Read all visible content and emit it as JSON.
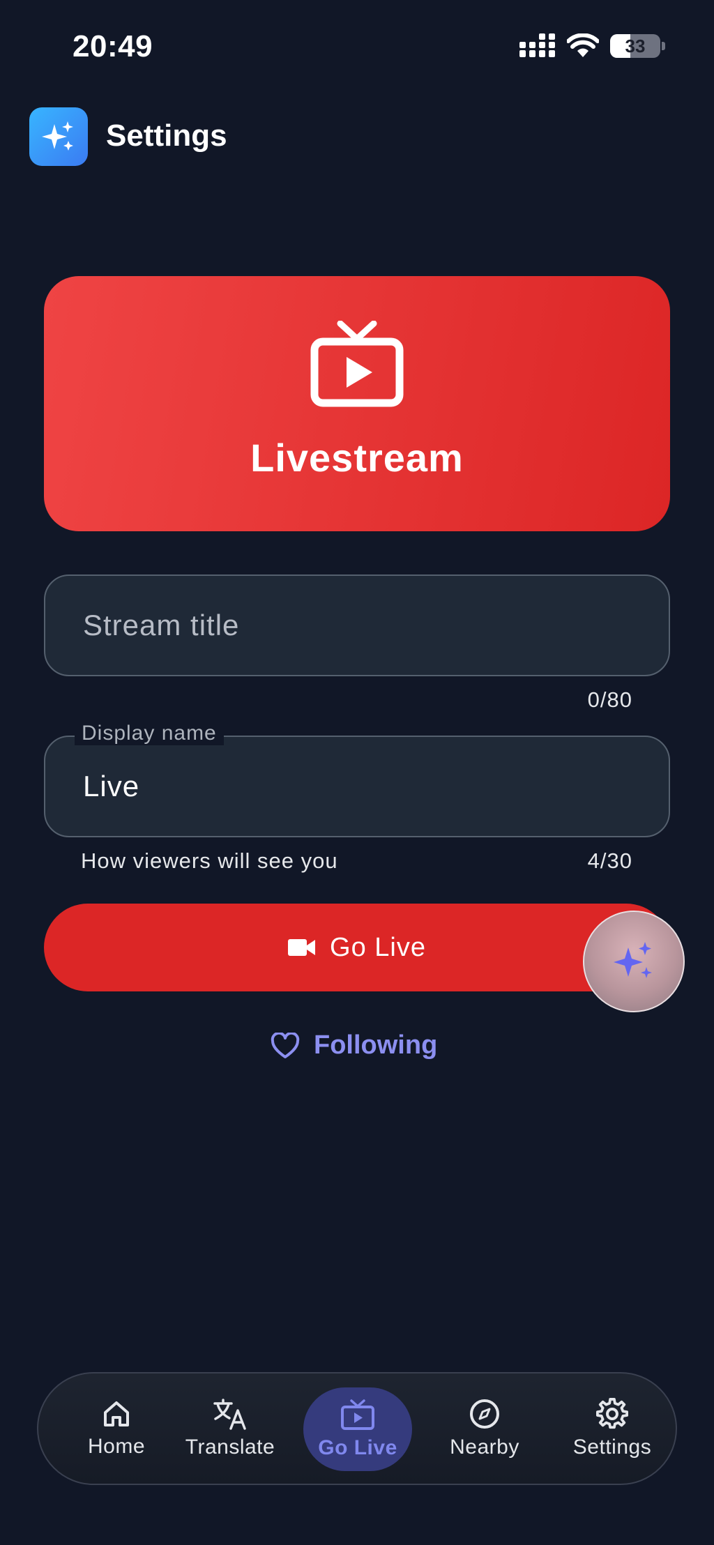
{
  "status_bar": {
    "time": "20:49",
    "battery": "33"
  },
  "header": {
    "title": "Settings"
  },
  "livestream_card": {
    "title": "Livestream"
  },
  "form": {
    "stream_title": {
      "placeholder": "Stream title",
      "value": "",
      "counter": "0/80"
    },
    "display_name": {
      "label": "Display name",
      "value": "Live",
      "helper": "How viewers will see you",
      "counter": "4/30"
    }
  },
  "go_live_button": {
    "label": "Go Live"
  },
  "following_link": {
    "label": "Following"
  },
  "bottom_nav": {
    "items": [
      {
        "label": "Home",
        "icon": "home-icon"
      },
      {
        "label": "Translate",
        "icon": "translate-icon"
      },
      {
        "label": "Go Live",
        "icon": "tv-icon",
        "active": true
      },
      {
        "label": "Nearby",
        "icon": "compass-icon"
      },
      {
        "label": "Settings",
        "icon": "gear-icon"
      }
    ]
  },
  "colors": {
    "background": "#111727",
    "live_red": "#dc2626",
    "accent": "#8088ee",
    "active_tab": "#353b7d"
  }
}
